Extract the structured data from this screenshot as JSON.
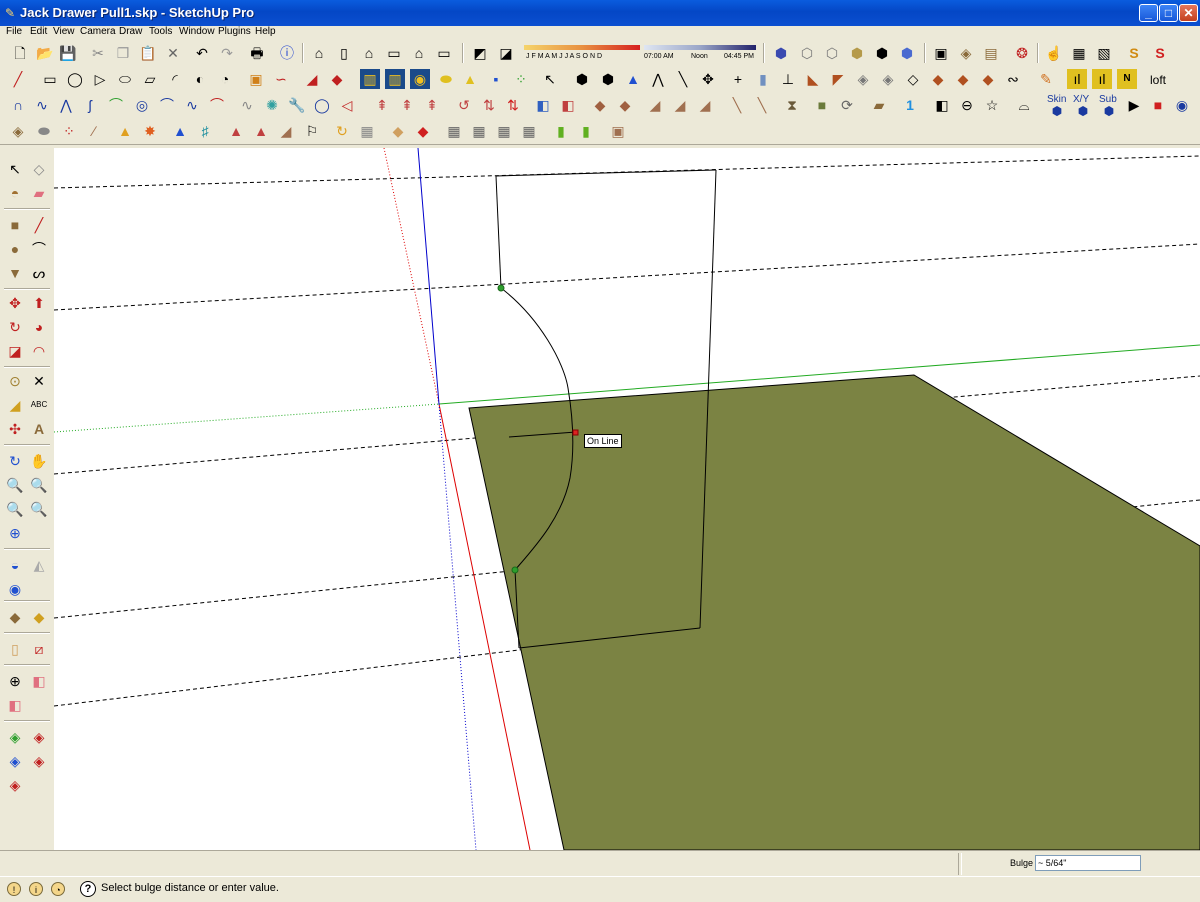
{
  "window": {
    "title": "Jack Drawer Pull1.skp - SketchUp Pro",
    "minimize_label": "_",
    "maximize_label": "□",
    "close_label": "✕"
  },
  "menu": [
    "File",
    "Edit",
    "View",
    "Camera",
    "Draw",
    "Tools",
    "Window",
    "Plugins",
    "Help"
  ],
  "shadow_settings": {
    "months": [
      "J",
      "F",
      "M",
      "A",
      "M",
      "J",
      "J",
      "A",
      "S",
      "O",
      "N",
      "D"
    ],
    "time_start": "07:00 AM",
    "time_mid": "Noon",
    "time_end": "04:45 PM"
  },
  "toolbar_text": {
    "loft": "loft",
    "skin": "Skin",
    "xyz": "X/Y",
    "sub": "Sub"
  },
  "toolbar_icons": {
    "row1": [
      "new-icon",
      "open-icon",
      "save-icon",
      "cut-icon",
      "copy-icon",
      "paste-icon",
      "erase-icon",
      "undo-icon",
      "redo-icon",
      "print-icon",
      "model-info-icon",
      "iso-view-icon",
      "front-view-icon",
      "home-view-icon",
      "top-view-icon",
      "right-view-icon",
      "back-view-icon",
      "shadow-settings-icon",
      "shadow-toggle-icon",
      "xray-icon",
      "wireframe-icon",
      "hidden-line-icon",
      "shaded-icon",
      "shaded-texture-icon",
      "monochrome-icon",
      "components-icon",
      "materials-icon",
      "styles-icon",
      "layers-icon",
      "hand-icon",
      "sandbox-icon",
      "scenes-icon",
      "ruby-icon",
      "ruby-console-icon"
    ],
    "row2": [
      "line-icon",
      "rectangle-icon",
      "circle-icon",
      "polygon-icon",
      "arc-icon",
      "freehand-icon",
      "pie-icon",
      "offset-icon",
      "follow-me-icon",
      "paint-icon",
      "fill-icon",
      "section-plane-icon",
      "solid-tools-icon",
      "cone-icon",
      "triangle-icon",
      "color-squares-icon",
      "select-icon",
      "box-icon",
      "sphere-icon",
      "pyramid-icon",
      "hinge-icon",
      "axes-icon",
      "plus-icon",
      "extrude-icon",
      "push-icon",
      "faces-icon",
      "pencil-icon"
    ],
    "row3": [
      "bezier-icon",
      "spline-icon",
      "polyline-icon",
      "cubic-icon",
      "catmull-icon",
      "spiral-icon",
      "arc-tangent-icon",
      "fillet-icon",
      "curve-icon",
      "wrench-icon",
      "blob-icon",
      "sector-icon",
      "joint-push-pull-icon",
      "vector-push-pull-icon",
      "normal-push-pull-icon",
      "rotate-axis-icon",
      "scale-axis-icon",
      "flip-icon",
      "select-group-icon",
      "cube-icon",
      "refresh-icon",
      "folder-icon",
      "one-icon",
      "stop-icon",
      "record-icon",
      "play-icon",
      "network-icon"
    ],
    "row4": [
      "drawer-icon",
      "wood-icon",
      "dots-icon",
      "chain-icon",
      "warning-icon",
      "sun-icon",
      "tree-icon",
      "spiral-arrows-icon",
      "cabinet-icon",
      "flag-icon",
      "loop-icon",
      "grid-cube-icon",
      "box-paint-icon",
      "lattice-icon",
      "bottle-icon",
      "crate-icon"
    ]
  },
  "left_toolbar_icons": [
    "select-icon",
    "component-icon",
    "paint-bucket-icon",
    "eraser-icon",
    "rectangle-icon",
    "line-icon",
    "circle-icon",
    "arc-icon",
    "polygon-icon",
    "freehand-icon",
    "move-icon",
    "push-pull-icon",
    "rotate-icon",
    "follow-me-icon",
    "scale-icon",
    "offset-icon",
    "tape-measure-icon",
    "dimension-icon",
    "protractor-icon",
    "text-icon",
    "axes-icon",
    "3d-text-icon",
    "orbit-icon",
    "pan-icon",
    "zoom-icon",
    "zoom-window-icon",
    "previous-view-icon",
    "next-view-icon",
    "zoom-extents-icon",
    "walk-icon",
    "get-models-icon",
    "share-model-icon",
    "google-earth-icon",
    "photo-icon",
    "get-model-icon",
    "share-icon",
    "section-plane-icon",
    "display-section-icon",
    "position-camera-icon",
    "look-around-icon",
    "solid-tool-icon",
    "outer-shell-icon",
    "intersect-icon",
    "union-icon",
    "subtract-icon",
    "trim-icon"
  ],
  "viewport": {
    "inference_tooltip": "On Line",
    "face_color": "#7b8343",
    "red_axis": "#dd0000",
    "green_axis": "#22aa22",
    "blue_axis": "#0000cc",
    "inference_point_color": "#2d9e2d",
    "endpoint_marker_color": "#dd2222"
  },
  "vcb": {
    "label": "Bulge",
    "value": "~ 5/64\""
  },
  "status": {
    "message": "Select bulge distance or enter value.",
    "help_icon": "?"
  }
}
